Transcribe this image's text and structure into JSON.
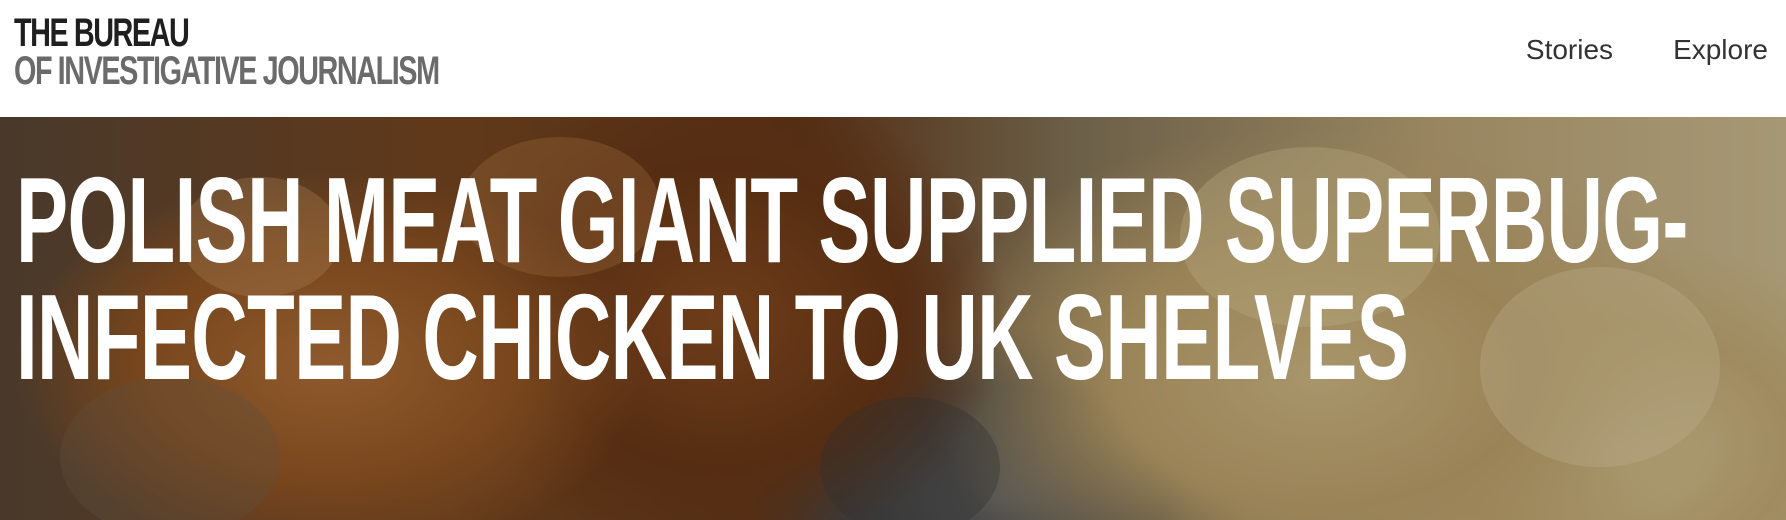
{
  "logo": {
    "line1": "THE BUREAU",
    "line2": "OF INVESTIGATIVE JOURNALISM"
  },
  "nav": {
    "items": [
      {
        "label": "Stories"
      },
      {
        "label": "Explore"
      }
    ]
  },
  "hero": {
    "headline_line1": "POLISH MEAT GIANT SUPPLIED SUPERBUG-",
    "headline_line2": "INFECTED CHICKEN TO UK SHELVES"
  }
}
